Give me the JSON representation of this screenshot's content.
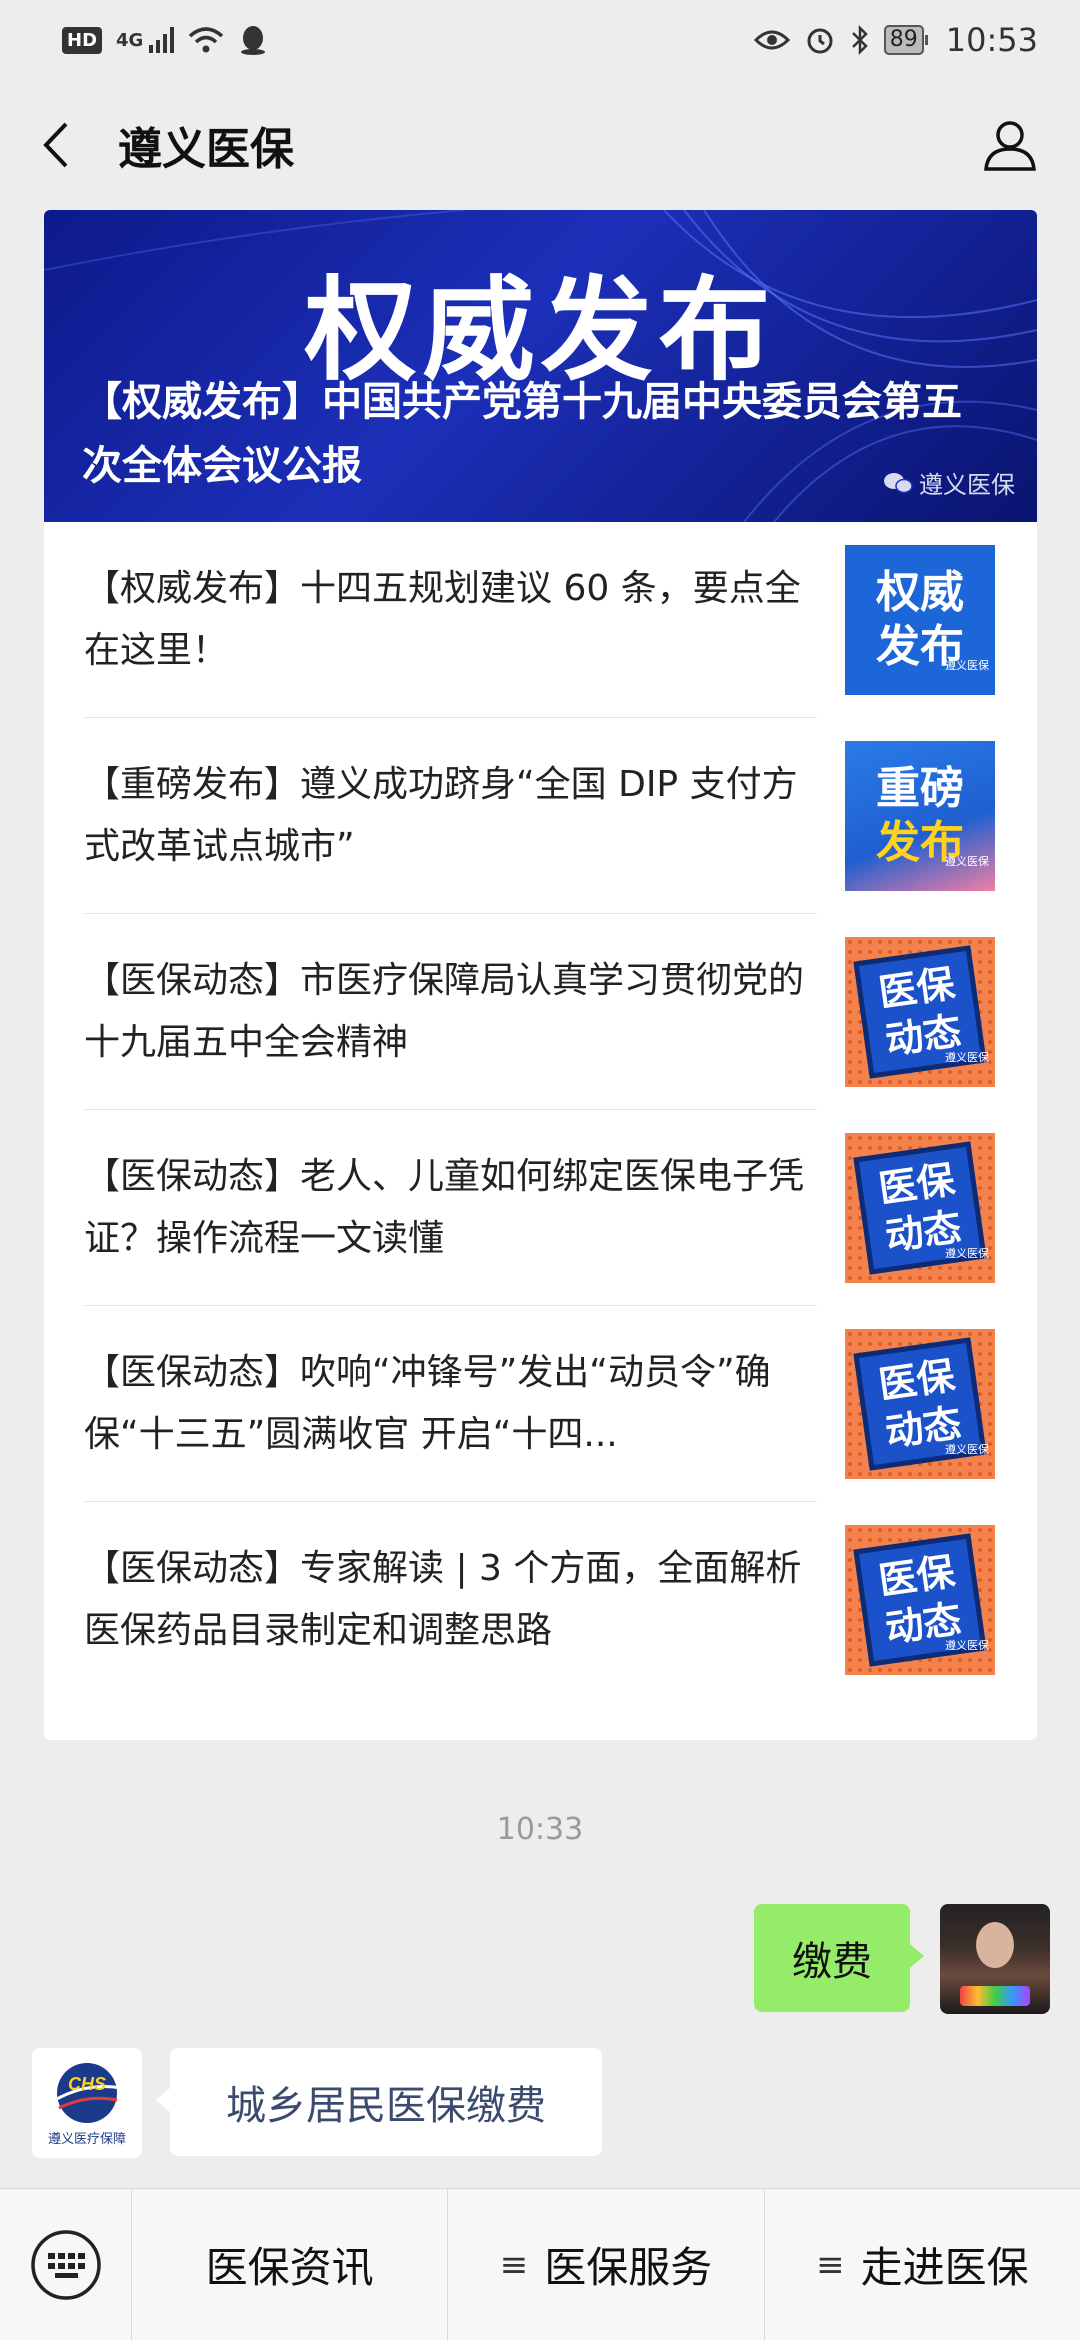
{
  "status_bar": {
    "hd": "HD",
    "network": "4G",
    "battery": "89",
    "time": "10:53"
  },
  "header": {
    "title": "遵义医保"
  },
  "banner": {
    "big_text": "权威发布",
    "headline": "【权威发布】中国共产党第十九届中央委员会第五次全体会议公报",
    "source": "遵义医保"
  },
  "articles": [
    {
      "title": "【权威发布】十四五规划建议 60 条，要点全在这里！",
      "thumb_line1": "权威",
      "thumb_line2": "发布",
      "thumb_tag": "遵义医保"
    },
    {
      "title": "【重磅发布】遵义成功跻身“全国 DIP 支付方式改革试点城市”",
      "thumb_line1": "重磅",
      "thumb_line2": "发布",
      "thumb_tag": "遵义医保"
    },
    {
      "title": "【医保动态】市医疗保障局认真学习贯彻党的十九届五中全会精神",
      "thumb_line1": "医保",
      "thumb_line2": "动态",
      "thumb_tag": "遵义医保"
    },
    {
      "title": "【医保动态】老人、儿童如何绑定医保电子凭证？操作流程一文读懂",
      "thumb_line1": "医保",
      "thumb_line2": "动态",
      "thumb_tag": "遵义医保"
    },
    {
      "title": "【医保动态】吹响“冲锋号”发出“动员令”确保“十三五”圆满收官 开启“十四...",
      "thumb_line1": "医保",
      "thumb_line2": "动态",
      "thumb_tag": "遵义医保"
    },
    {
      "title": "【医保动态】专家解读 | 3 个方面，全面解析医保药品目录制定和调整思路",
      "thumb_line1": "医保",
      "thumb_line2": "动态",
      "thumb_tag": "遵义医保"
    }
  ],
  "chat": {
    "time": "10:33",
    "user_message": "缴费",
    "bot_message": "城乡居民医保缴费",
    "bot_logo_text": "CHS",
    "bot_caption": "遵义医疗保障"
  },
  "bottom_menu": {
    "items": [
      "医保资讯",
      "医保服务",
      "走进医保"
    ],
    "hamburger_glyph": "≡"
  },
  "colors": {
    "banner_blue": "#1c2fb8",
    "user_bubble": "#95ec69",
    "thumb_orange": "#f4824d",
    "thumb_blue": "#1d66d8"
  }
}
